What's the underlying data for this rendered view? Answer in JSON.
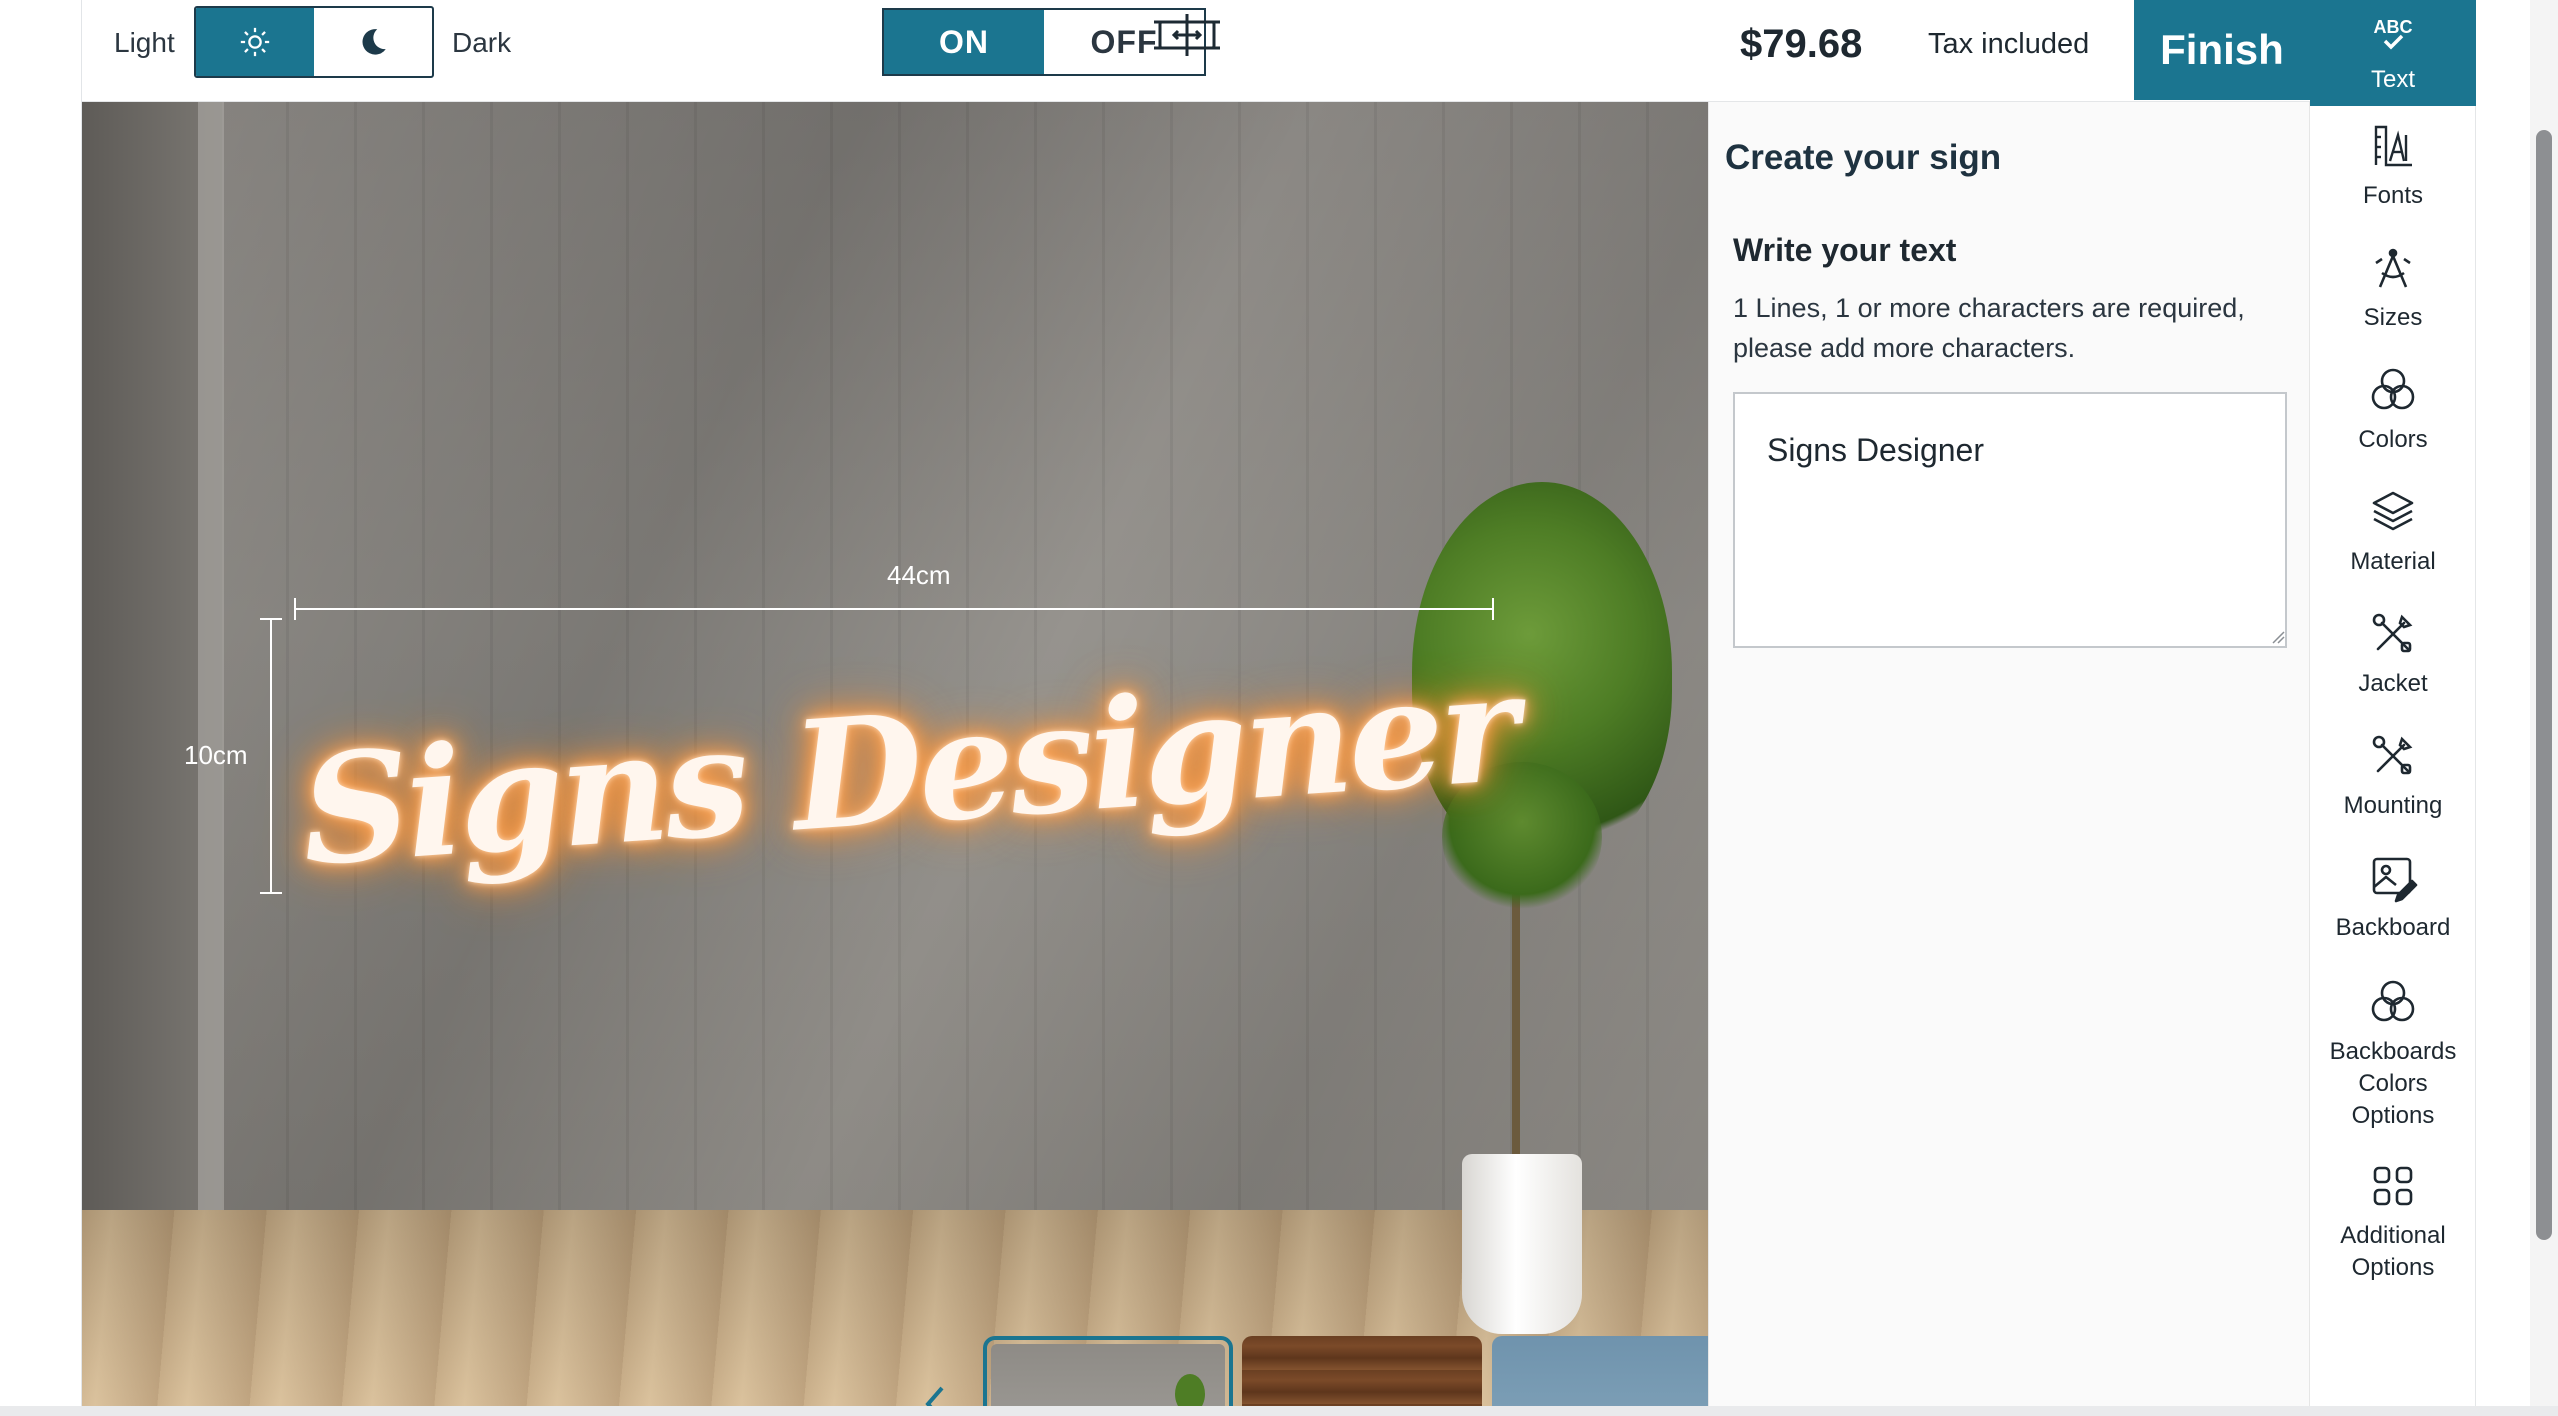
{
  "topbar": {
    "light_label": "Light",
    "dark_label": "Dark",
    "mode_icons": [
      "sun-icon",
      "moon-icon"
    ],
    "light_on": "ON",
    "light_off": "OFF",
    "dims_icon": "ruler-icon",
    "price": "$79.68",
    "tax_note": "Tax included",
    "finish_label": "Finish"
  },
  "preview": {
    "sign_text": "Signs Designer",
    "width_label": "44cm",
    "height_label": "10cm",
    "neon_color": "#ff9a3c",
    "thumbnails": [
      "concrete-wall-scene",
      "wood-plank-scene",
      "blue-room-scene"
    ],
    "selected_thumbnail": 0
  },
  "panel": {
    "title": "Create your sign",
    "section_title": "Write your text",
    "hint": "1 Lines, 1 or more characters are required, please add more characters.",
    "text_value": "Signs Designer"
  },
  "sidenav": {
    "items": [
      {
        "label": "Text",
        "icon": "abc-check-icon",
        "active": true
      },
      {
        "label": "Fonts",
        "icon": "fonts-icon"
      },
      {
        "label": "Sizes",
        "icon": "sizes-icon"
      },
      {
        "label": "Colors",
        "icon": "colors-icon"
      },
      {
        "label": "Material",
        "icon": "material-icon"
      },
      {
        "label": "Jacket",
        "icon": "jacket-icon"
      },
      {
        "label": "Mounting",
        "icon": "mounting-icon"
      },
      {
        "label": "Backboard",
        "icon": "backboard-icon"
      },
      {
        "label": "Backboards Colors Options",
        "icon": "backboard-colors-icon"
      },
      {
        "label": "Additional Options",
        "icon": "additional-options-icon"
      }
    ]
  },
  "colors": {
    "accent": "#1b7590",
    "dark_text": "#1e2830"
  }
}
